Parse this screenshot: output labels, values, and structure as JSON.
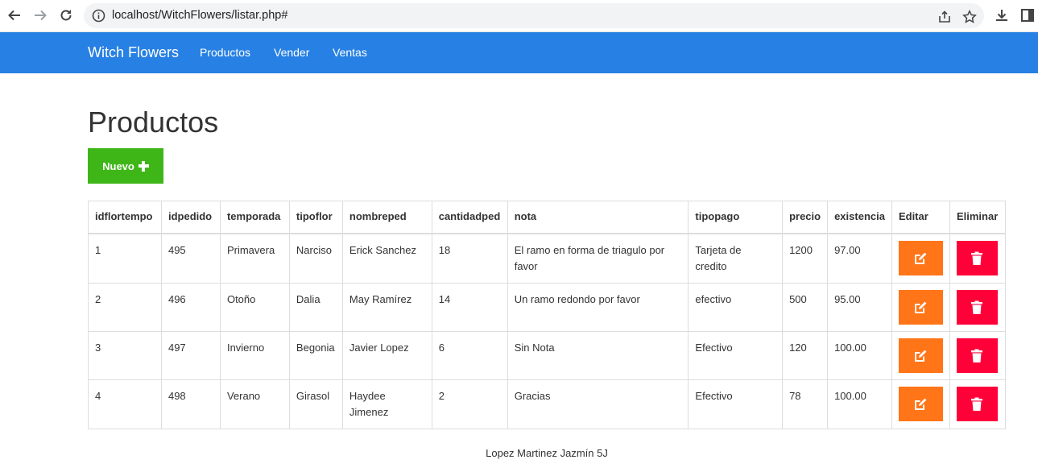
{
  "browser": {
    "url": "localhost/WitchFlowers/listar.php#",
    "icons": [
      "back-icon",
      "forward-icon",
      "reload-icon",
      "info-icon",
      "share-icon",
      "bookmark-star-icon",
      "download-icon",
      "side-panel-icon"
    ]
  },
  "navbar": {
    "brand": "Witch Flowers",
    "links": [
      "Productos",
      "Vender",
      "Ventas"
    ],
    "color": "#2780e3"
  },
  "main": {
    "title": "Productos",
    "new_button_label": "Nuevo"
  },
  "table": {
    "headers": [
      "idflortempo",
      "idpedido",
      "temporada",
      "tipoflor",
      "nombreped",
      "cantidadped",
      "nota",
      "tipopago",
      "precio",
      "existencia",
      "Editar",
      "Eliminar"
    ],
    "rows": [
      [
        "1",
        "495",
        "Primavera",
        "Narciso",
        "Erick Sanchez",
        "18",
        "El ramo en forma de triagulo por favor",
        "Tarjeta de credito",
        "1200",
        "97.00"
      ],
      [
        "2",
        "496",
        "Otoño",
        "Dalia",
        "May Ramírez",
        "14",
        "Un ramo redondo por favor",
        "efectivo",
        "500",
        "95.00"
      ],
      [
        "3",
        "497",
        "Invierno",
        "Begonia",
        "Javier Lopez",
        "6",
        "Sin Nota",
        "Efectivo",
        "120",
        "100.00"
      ],
      [
        "4",
        "498",
        "Verano",
        "Girasol",
        "Haydee Jimenez",
        "2",
        "Gracias",
        "Efectivo",
        "78",
        "100.00"
      ]
    ],
    "edit_color": "#ff7518",
    "delete_color": "#ff0039"
  },
  "footer": {
    "text": "Lopez Martinez Jazmín 5J"
  }
}
